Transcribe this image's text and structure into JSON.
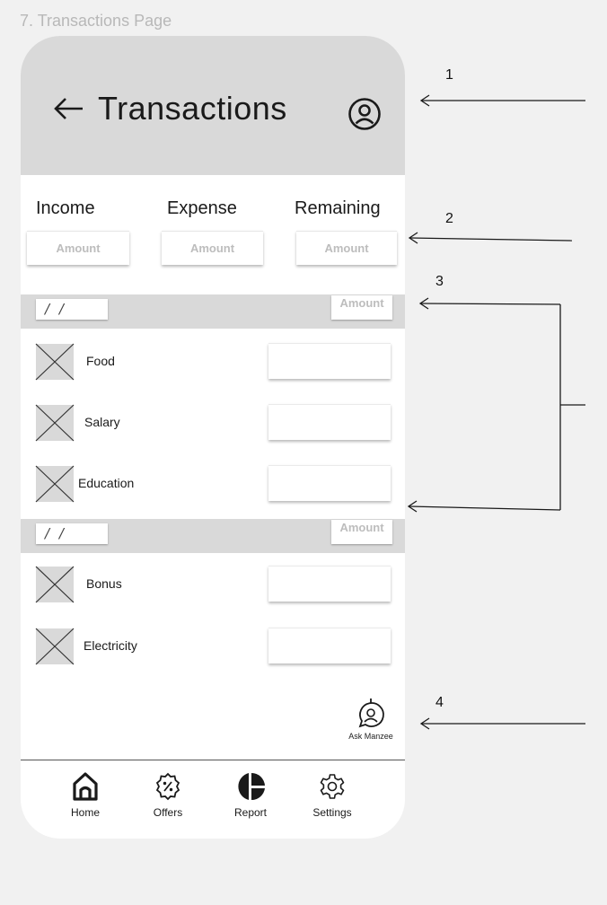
{
  "canvas": {
    "caption": "7. Transactions Page"
  },
  "header": {
    "title": "Transactions"
  },
  "summary": {
    "labels": [
      "Income",
      "Expense",
      "Remaining"
    ],
    "placeholders": [
      "Amount",
      "Amount",
      "Amount"
    ]
  },
  "groups": [
    {
      "date_text": "/ /",
      "amount_placeholder": "Amount",
      "items": [
        {
          "label": "Food"
        },
        {
          "label": "Salary"
        },
        {
          "label": "Education"
        }
      ]
    },
    {
      "date_text": "/ /",
      "amount_placeholder": "Amount",
      "items": [
        {
          "label": "Bonus"
        },
        {
          "label": "Electricity"
        }
      ]
    }
  ],
  "assistant": {
    "label": "Ask Manzee"
  },
  "bottom_nav": {
    "items": [
      {
        "label": "Home",
        "icon": "home-icon"
      },
      {
        "label": "Offers",
        "icon": "offers-icon"
      },
      {
        "label": "Report",
        "icon": "report-icon"
      },
      {
        "label": "Settings",
        "icon": "settings-icon"
      }
    ]
  },
  "annotations": [
    "1",
    "2",
    "3",
    "4"
  ]
}
